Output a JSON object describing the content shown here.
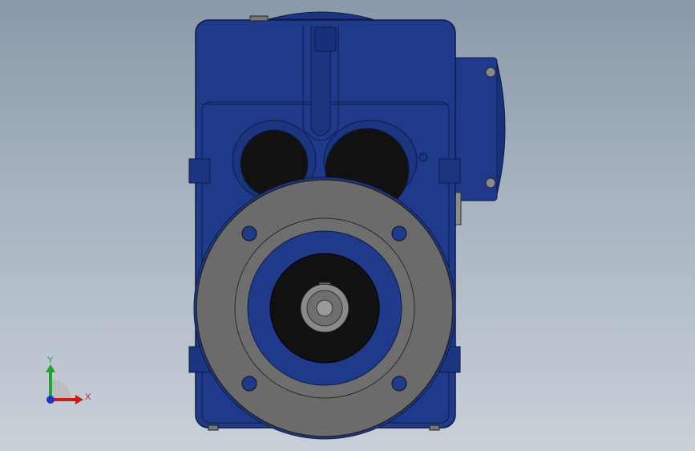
{
  "viewport": {
    "background_top": "#8a99aa",
    "background_bottom": "#c9d0d8"
  },
  "model": {
    "body_color": "#1f3a8a",
    "body_shadow": "#14276a",
    "flange_color": "#6b6b6b",
    "bore_color": "#111111",
    "shaft_color": "#7a7a7a"
  },
  "triad": {
    "x_label": "X",
    "y_label": "Y",
    "x_color": "#cc1b1b",
    "y_color": "#22a033",
    "z_color": "#2233cc"
  }
}
